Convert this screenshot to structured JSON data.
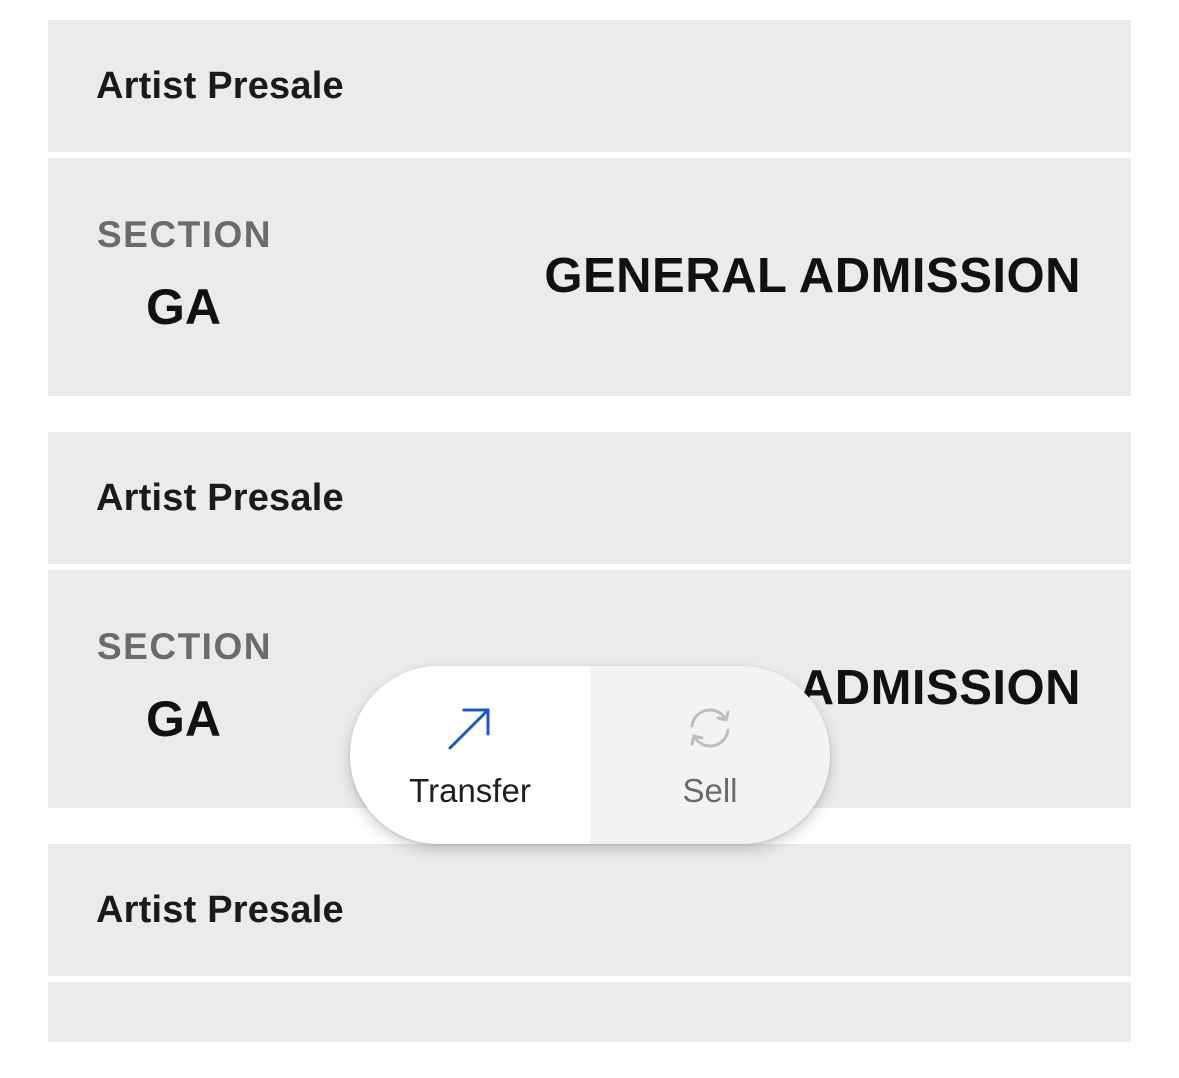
{
  "tickets": [
    {
      "presale_label": "Artist Presale",
      "section_caption": "SECTION",
      "section_value": "GA",
      "admission_label": "GENERAL ADMISSION"
    },
    {
      "presale_label": "Artist Presale",
      "section_caption": "SECTION",
      "section_value": "GA",
      "admission_label": "GENERAL ADMISSION"
    },
    {
      "presale_label": "Artist Presale"
    }
  ],
  "actions": {
    "transfer": {
      "label": "Transfer",
      "icon": "arrow-up-right-icon",
      "color": "#1a56c8"
    },
    "sell": {
      "label": "Sell",
      "icon": "refresh-icon",
      "color": "#bdbdbd"
    }
  },
  "colors": {
    "panel_background": "#ebebeb",
    "page_background": "#ffffff",
    "caption_gray": "#6b6b6b"
  }
}
